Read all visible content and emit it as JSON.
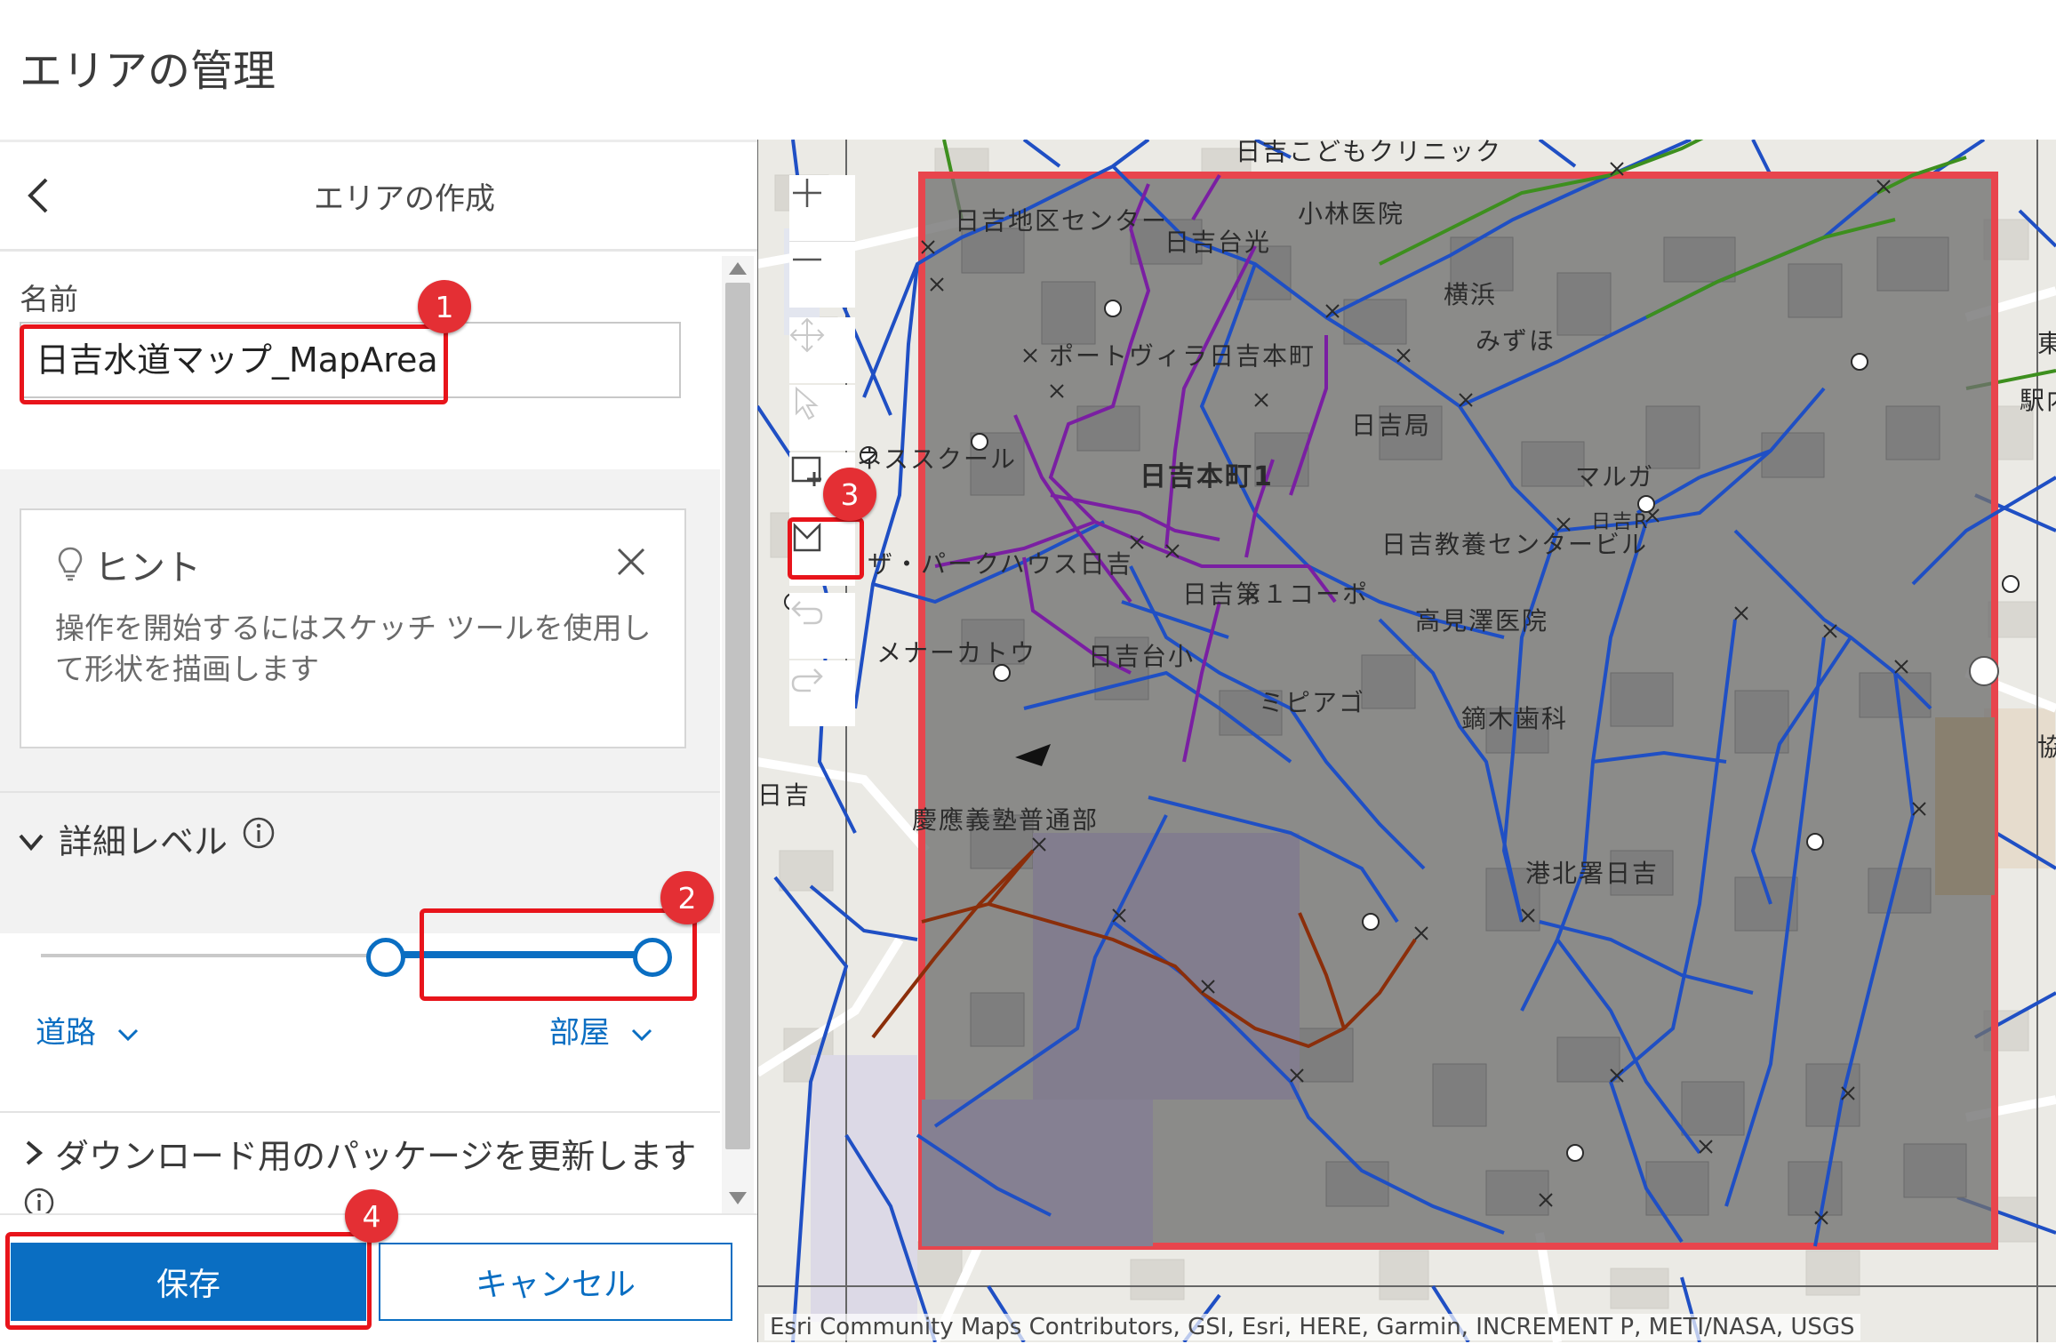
{
  "header": {
    "title": "エリアの管理"
  },
  "panel": {
    "heading": "エリアの作成",
    "name": {
      "label": "名前",
      "value": "日吉水道マップ_MapArea"
    },
    "hint": {
      "title": "ヒント",
      "body": "操作を開始するにはスケッチ ツールを使用して形状を描画します"
    },
    "detail_level": {
      "title": "詳細レベル",
      "min_label": "道路",
      "max_label": "部屋",
      "range": [
        0.55,
        1.0
      ]
    },
    "package": {
      "title": "ダウンロード用のパッケージを更新します"
    },
    "buttons": {
      "save": "保存",
      "cancel": "キャンセル"
    }
  },
  "callouts": [
    "1",
    "2",
    "3",
    "4"
  ],
  "map": {
    "labels": [
      "日吉こどもクリニック",
      "日吉地区センター",
      "日吉台光",
      "小林医院",
      "横浜",
      "みずほ",
      "ポートヴィラ日吉本町",
      "日吉局",
      "日吉本町1",
      "ネススクール",
      "マルガ",
      "日吉R",
      "日吉教養センタービル",
      "ザ・パークハウス日吉",
      "日吉第１コーポ",
      "高見澤医院",
      "メナーカトウ",
      "日吉台小",
      "ミピアゴ",
      "鏑木歯科",
      "慶應義塾普通部",
      "港北署日吉",
      "東",
      "駅内",
      "協",
      "日吉"
    ],
    "attribution": "Esri Community Maps Contributors, GSI, Esri, HERE, Garmin, INCREMENT P, METI/NASA, USGS"
  },
  "colors": {
    "accent": "#0a6ec2",
    "callout": "#e42f34",
    "highlight": "#e8141b",
    "area_outline": "#e8454d"
  },
  "icons": [
    "chevron-left-icon",
    "lightbulb-icon",
    "close-icon",
    "chevron-down-icon",
    "info-icon",
    "chevron-right-icon",
    "zoom-in-icon",
    "zoom-out-icon",
    "pan-icon",
    "select-icon",
    "add-rectangle-icon",
    "draw-polygon-icon",
    "undo-icon",
    "redo-icon"
  ]
}
